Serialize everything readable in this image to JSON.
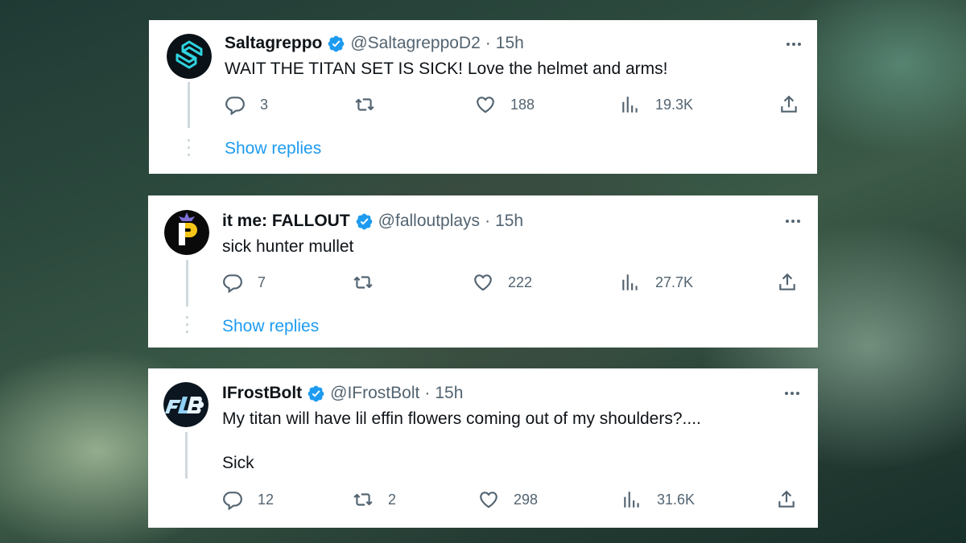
{
  "tweets": [
    {
      "name": "Saltagreppo",
      "handle": "@SaltagreppoD2",
      "separator": "·",
      "time": "15h",
      "text_lines": [
        "WAIT THE TITAN SET IS SICK! Love the helmet and arms!"
      ],
      "replies": "3",
      "retweets": "",
      "likes": "188",
      "views": "19.3K",
      "show_replies": "Show replies",
      "avatar_icon": "saltagreppo-logo",
      "avatar_colors": [
        "#0b1217",
        "#2fd3e0"
      ]
    },
    {
      "name": "it me: FALLOUT",
      "handle": "@falloutplays",
      "separator": "·",
      "time": "15h",
      "text_lines": [
        "sick hunter mullet"
      ],
      "replies": "7",
      "retweets": "",
      "likes": "222",
      "views": "27.7K",
      "show_replies": "Show replies",
      "avatar_icon": "fallout-p-logo",
      "avatar_colors": [
        "#0a0a0a",
        "#f5c518"
      ]
    },
    {
      "name": "IFrostBolt",
      "handle": "@IFrostBolt",
      "separator": "·",
      "time": "15h",
      "text_lines": [
        "My titan will have lil effin flowers coming out of my shoulders?....",
        "",
        "Sick"
      ],
      "replies": "12",
      "retweets": "2",
      "likes": "298",
      "views": "31.6K",
      "avatar_icon": "frostbolt-logo",
      "avatar_colors": [
        "#0b1620",
        "#bfe6ff"
      ]
    }
  ],
  "colors": {
    "verified": "#1d9bf0",
    "link": "#1d9bf0",
    "muted": "#536471",
    "text": "#0f1419"
  },
  "icons": [
    "reply-icon",
    "retweet-icon",
    "like-icon",
    "views-icon",
    "share-icon",
    "more-icon",
    "verified-badge-icon"
  ]
}
